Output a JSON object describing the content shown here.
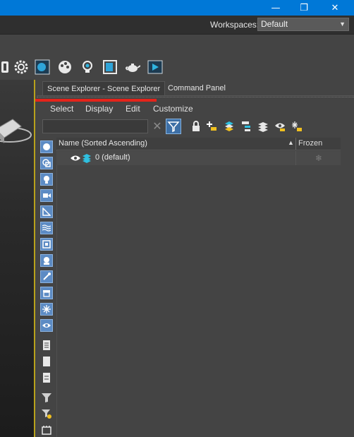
{
  "window": {
    "minimize_glyph": "—",
    "restore_glyph": "❐",
    "close_glyph": "✕",
    "title_bar_color": "#0078d7"
  },
  "workspace": {
    "label": "Workspaces:",
    "selected": "Default",
    "arrow_glyph": "▼"
  },
  "toolbar": {
    "icons": [
      "shader-icon",
      "gear-icon",
      "material-editor-icon",
      "palette-icon",
      "light-bulb-icon",
      "render-frame-icon",
      "teapot-icon",
      "render-icon"
    ]
  },
  "scene_explorer": {
    "tabs": [
      {
        "label": "Scene Explorer - Scene Explorer",
        "active": true
      },
      {
        "label": "Command Panel",
        "active": false
      }
    ],
    "menu": [
      "Select",
      "Display",
      "Edit",
      "Customize"
    ],
    "search": {
      "value": "",
      "placeholder": ""
    },
    "clear_glyph": "✕",
    "toolbar_icons": [
      "lock-icon",
      "add-layer-icon",
      "layers-icon",
      "hierarchy-icon",
      "stack-icon",
      "eye-layer-icon",
      "freeze-layer-icon"
    ],
    "filter_icons": [
      "geometry-icon",
      "shapes-icon",
      "lights-icon",
      "cameras-icon",
      "helpers-icon",
      "space-warps-icon",
      "groups-icon",
      "xrefs-icon",
      "bones-icon",
      "containers-icon",
      "frozen-icon",
      "hidden-icon",
      "display-all-icon",
      "display-none-icon",
      "invert-display-icon",
      "filter-icon",
      "filter-settings-icon",
      "bone-settings-icon"
    ],
    "table": {
      "columns": {
        "name": "Name (Sorted Ascending)",
        "sort_glyph": "▲",
        "frozen": "Frozen"
      },
      "rows": [
        {
          "label": "0 (default)",
          "frozen_glyph": "❄"
        }
      ]
    },
    "highlight_color": "#e5231a"
  }
}
